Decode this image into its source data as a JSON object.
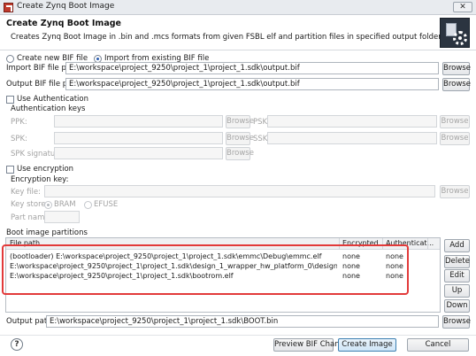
{
  "window": {
    "title": "Create Zynq Boot Image",
    "close_glyph": "✕"
  },
  "header": {
    "title": "Create Zynq Boot Image",
    "description": "Creates Zynq Boot Image in .bin and .mcs formats from given FSBL elf and partition files in specified output folder."
  },
  "bif_mode": {
    "create_new_label": "Create new BIF file",
    "import_label": "Import from existing BIF file",
    "selected": "import"
  },
  "import_bif": {
    "label": "Import BIF file path:",
    "value": "E:\\workspace\\project_9250\\project_1\\project_1.sdk\\output.bif",
    "browse_label": "Browse"
  },
  "output_bif": {
    "label": "Output BIF file path:",
    "value": "E:\\workspace\\project_9250\\project_1\\project_1.sdk\\output.bif",
    "browse_label": "Browse"
  },
  "authentication": {
    "checkbox_label": "Use Authentication",
    "group_label": "Authentication keys",
    "ppk_label": "PPK:",
    "psk_label": "PSK:",
    "spk_label": "SPK:",
    "ssk_label": "SSK:",
    "spk_signature_label": "SPK signature:",
    "browse_label": "Browse"
  },
  "encryption": {
    "checkbox_label": "Use encryption",
    "group_label": "Encryption key:",
    "key_file_label": "Key file:",
    "key_store_label": "Key store:",
    "bram_label": "BRAM",
    "efuse_label": "EFUSE",
    "part_name_label": "Part name:",
    "browse_label": "Browse"
  },
  "partitions": {
    "section_label": "Boot image partitions",
    "columns": [
      "File path",
      "Encrypted",
      "Authenticat..."
    ],
    "rows": [
      {
        "path": "(bootloader) E:\\workspace\\project_9250\\project_1\\project_1.sdk\\emmc\\Debug\\emmc.elf",
        "encrypted": "none",
        "authenticated": "none"
      },
      {
        "path": "E:\\workspace\\project_9250\\project_1\\project_1.sdk\\design_1_wrapper_hw_platform_0\\design_1_wrapper.bit",
        "encrypted": "none",
        "authenticated": "none"
      },
      {
        "path": "E:\\workspace\\project_9250\\project_1\\project_1.sdk\\bootrom.elf",
        "encrypted": "none",
        "authenticated": "none"
      }
    ],
    "buttons": {
      "add": "Add",
      "delete": "Delete",
      "edit": "Edit",
      "up": "Up",
      "down": "Down"
    },
    "highlight_color": "#e23a3a"
  },
  "output_path": {
    "label": "Output path:",
    "value": "E:\\workspace\\project_9250\\project_1\\project_1.sdk\\BOOT.bin",
    "browse_label": "Browse"
  },
  "footer": {
    "help_glyph": "?",
    "preview_label": "Preview BIF Changes",
    "create_label": "Create Image",
    "cancel_label": "Cancel"
  },
  "icons": {
    "app": "xilinx-sdk-icon",
    "logo": "boot-image-gear-icon",
    "help": "help-icon"
  }
}
